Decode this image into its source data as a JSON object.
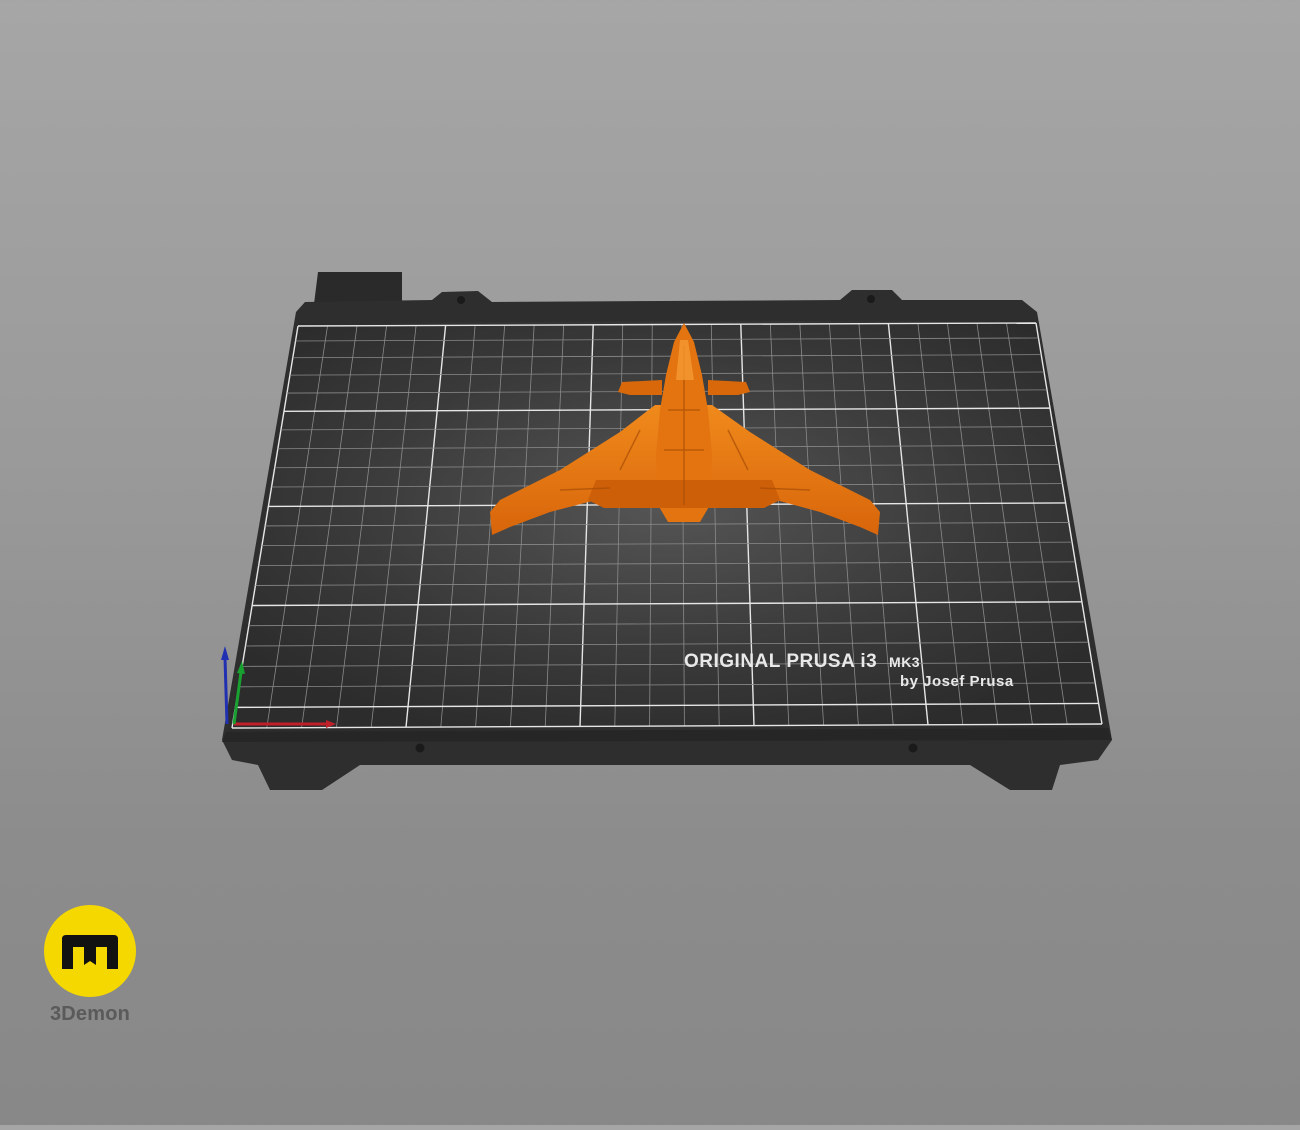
{
  "viewer": {
    "scene": "3d-print-bed-preview",
    "model_color": "#e06f0a",
    "bed_color": "#2f2f2f"
  },
  "bed": {
    "brand_line1": "ORIGINAL PRUSA i3",
    "brand_line1_suffix": "MK3",
    "brand_line2": "by Josef Prusa"
  },
  "axes": {
    "x_color": "#c0202a",
    "y_color": "#18a030",
    "z_color": "#2030b0"
  },
  "logo": {
    "text": "3Demon",
    "icon": "3demon-logo-icon",
    "color": "#f5d800"
  }
}
